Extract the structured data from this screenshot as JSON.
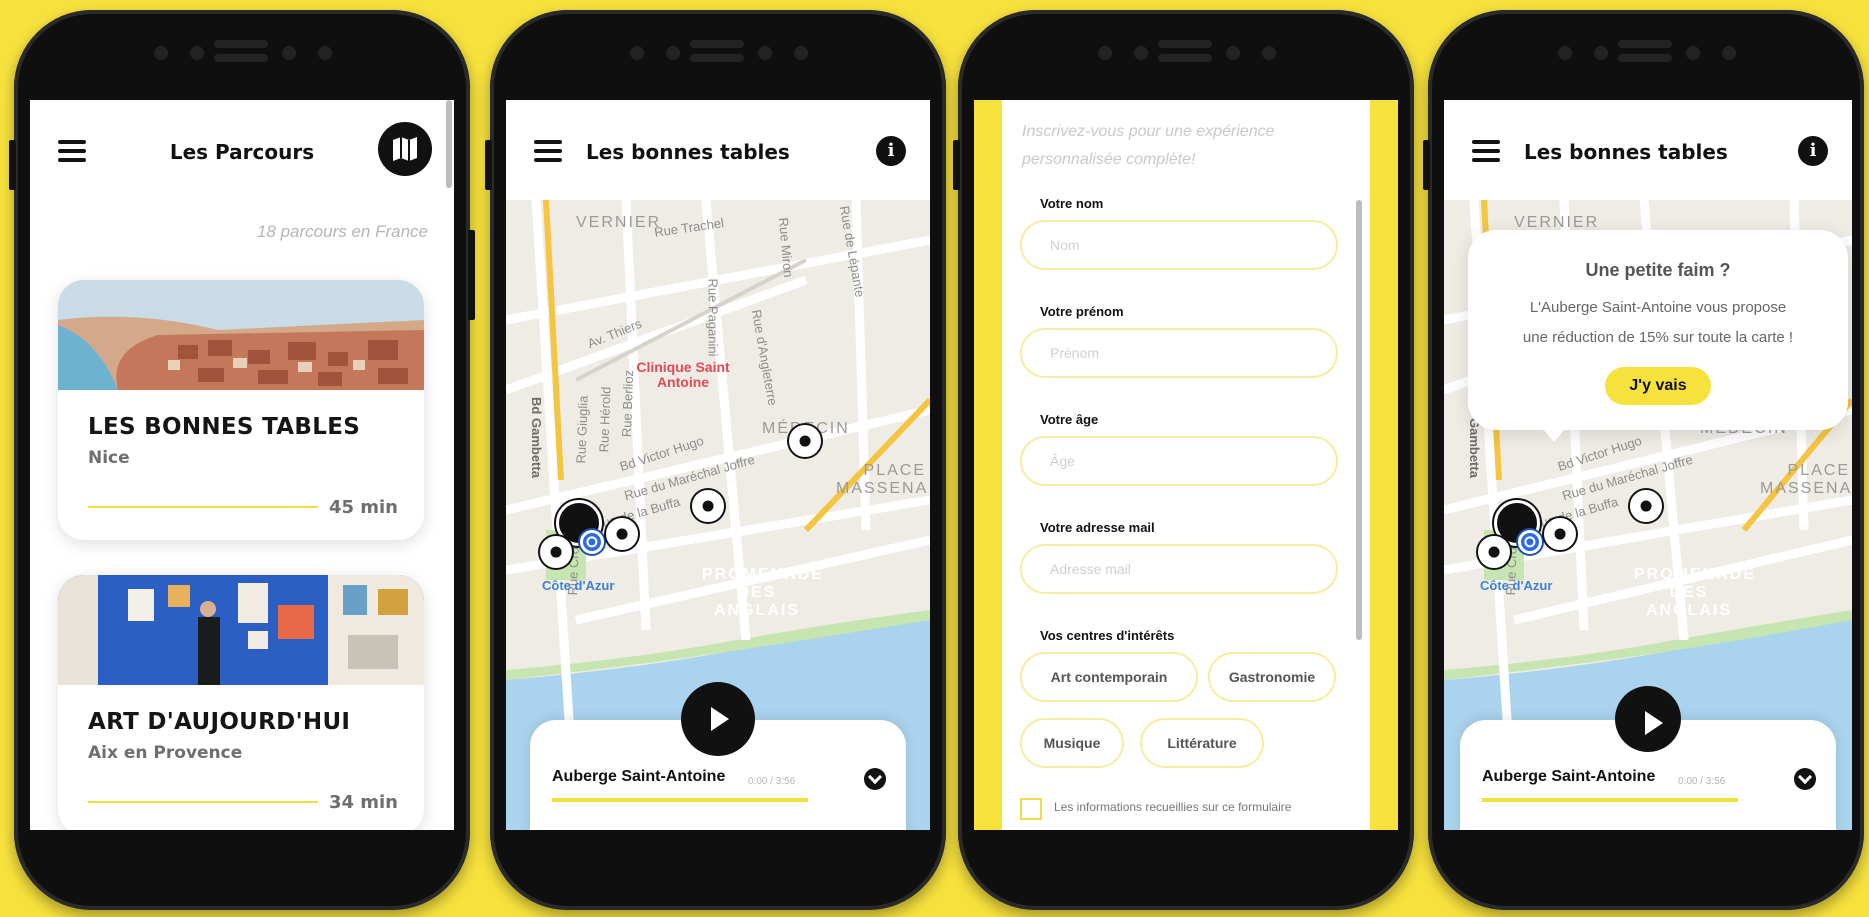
{
  "colors": {
    "background": "#f7e23d",
    "accent": "#f4e03a",
    "dark": "#111111",
    "muted_text": "#6e6e6e",
    "placeholder": "#d0d0d0"
  },
  "screen1": {
    "title": "Les Parcours",
    "count_text": "18 parcours en France",
    "cards": [
      {
        "title": "LES BONNES TABLES",
        "city": "Nice",
        "duration": "45 min",
        "image_icon": "coastal-city-photo"
      },
      {
        "title": "ART D'AUJOURD'HUI",
        "city": "Aix en Provence",
        "duration": "34 min",
        "image_icon": "art-gallery-photo"
      }
    ]
  },
  "screen2": {
    "title": "Les bonnes tables",
    "map_labels": {
      "vernier": "VERNIER",
      "rue_trachel": "Rue Trachel",
      "av_thiers": "Av. Thiers",
      "rue_paganini": "Rue Paganini",
      "rue_angleterre": "Rue d'Angleterre",
      "rue_lepante": "Rue de Lépante",
      "rue_miron": "Rue Miron",
      "clinique": "Clinique Saint Antoine",
      "bd_gambetta": "Bd Gambetta",
      "rue_giuglia": "Rue Giuglia",
      "rue_herold": "Rue Hérold",
      "rue_berlioz": "Rue Berlioz",
      "bd_victor_hugo": "Bd Victor Hugo",
      "rue_marechal": "Rue du Maréchal Joffre",
      "rue_buffa": "Rue de la Buffa",
      "medecin": "MÉDECIN",
      "massena": "PLACE MASSENA",
      "rue_cronstadt": "Rue Cronstadt",
      "promenade": "PROMENADE DES ANGLAIS",
      "cote_azur": "Côte d'Azur"
    },
    "player": {
      "track": "Auberge Saint-Antoine",
      "time": "0:00 / 3:56"
    }
  },
  "screen3": {
    "intro": "Inscrivez-vous pour une expérience personnalisée complète!",
    "fields": [
      {
        "label": "Votre nom",
        "placeholder": "Nom"
      },
      {
        "label": "Votre prénom",
        "placeholder": "Prénom"
      },
      {
        "label": "Votre âge",
        "placeholder": "Âge"
      },
      {
        "label": "Votre adresse mail",
        "placeholder": "Adresse mail"
      }
    ],
    "interests_label": "Vos centres d'intérêts",
    "interests": [
      "Art contemporain",
      "Gastronomie",
      "Musique",
      "Littérature"
    ],
    "consent_text": "Les informations recueillies sur ce formulaire"
  },
  "screen4": {
    "title": "Les bonnes tables",
    "popup": {
      "title": "Une petite faim ?",
      "text_line1": "L'Auberge Saint-Antoine vous propose",
      "text_line2": "une réduction de 15% sur toute la carte !",
      "cta": "J'y vais"
    },
    "player": {
      "track": "Auberge Saint-Antoine",
      "time": "0:00 / 3:56"
    }
  }
}
